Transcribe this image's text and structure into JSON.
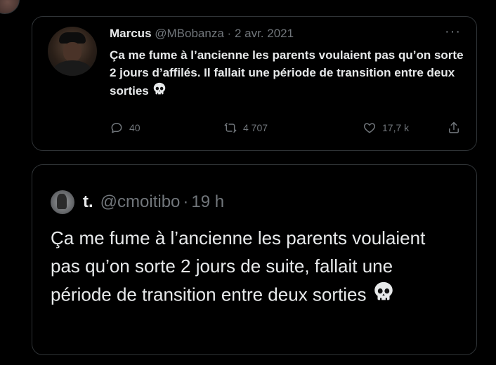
{
  "quoted_tweet": {
    "author_name": "Marcus",
    "handle": "@MBobanza",
    "separator": "·",
    "date": "2 avr. 2021",
    "more_label": "···",
    "text": "Ça me fume à l’ancienne les parents voulaient pas qu’on sorte 2 jours d’affilés. Il fallait une période de transition entre deux sorties",
    "emoji": "skull",
    "reply_count": "40",
    "retweet_count": "4 707",
    "like_count": "17,7 k"
  },
  "tweet": {
    "author_name": "t.",
    "handle": "@cmoitibo",
    "separator": "·",
    "date": "19 h",
    "text": "Ça me fume à l’ancienne les parents voulaient pas qu’on sorte 2 jours de suite, fallait une période de transition entre deux sorties",
    "emoji": "skull"
  },
  "colors": {
    "background": "#000000",
    "text_primary": "#e7e9ea",
    "text_secondary": "#71767b",
    "border": "#2f3336"
  },
  "icons": {
    "reply": "reply-icon",
    "retweet": "retweet-icon",
    "like": "heart-icon",
    "share": "share-icon",
    "more": "more-icon",
    "emoji": "skull-icon"
  }
}
